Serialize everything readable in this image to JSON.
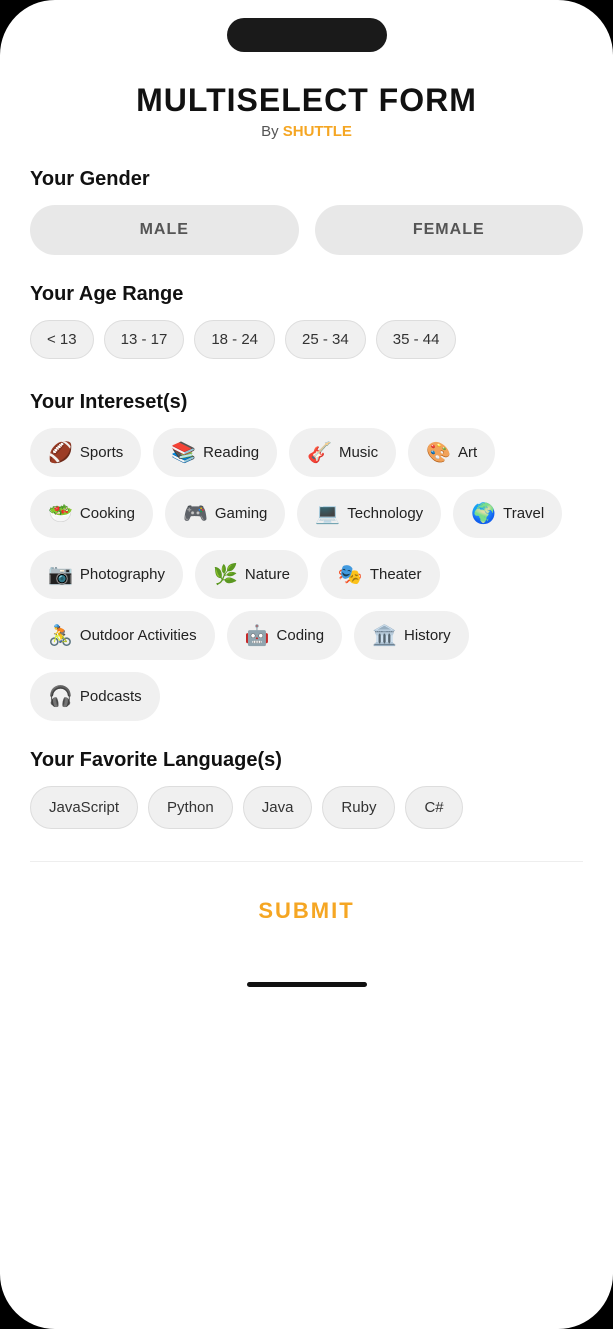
{
  "app": {
    "title": "MULTISELECT FORM",
    "byLine": "By",
    "brand": "SHUTTLE"
  },
  "gender": {
    "label": "Your Gender",
    "options": [
      "MALE",
      "FEMALE"
    ]
  },
  "ageRange": {
    "label": "Your Age Range",
    "options": [
      "< 13",
      "13 - 17",
      "18 - 24",
      "25 - 34",
      "35 - 44"
    ]
  },
  "interests": {
    "label": "Your Intereset(s)",
    "items": [
      {
        "emoji": "🏈",
        "label": "Sports"
      },
      {
        "emoji": "📚",
        "label": "Reading"
      },
      {
        "emoji": "🎸",
        "label": "Music"
      },
      {
        "emoji": "🎨",
        "label": "Art"
      },
      {
        "emoji": "🥗",
        "label": "Cooking"
      },
      {
        "emoji": "🎮",
        "label": "Gaming"
      },
      {
        "emoji": "💻",
        "label": "Technology"
      },
      {
        "emoji": "🌍",
        "label": "Travel"
      },
      {
        "emoji": "📷",
        "label": "Photography"
      },
      {
        "emoji": "🌿",
        "label": "Nature"
      },
      {
        "emoji": "🎭",
        "label": "Theater"
      },
      {
        "emoji": "🚴",
        "label": "Outdoor Activities"
      },
      {
        "emoji": "🤖",
        "label": "Coding"
      },
      {
        "emoji": "🏛️",
        "label": "History"
      },
      {
        "emoji": "🎧",
        "label": "Podcasts"
      }
    ]
  },
  "languages": {
    "label": "Your Favorite Language(s)",
    "options": [
      "JavaScript",
      "Python",
      "Java",
      "Ruby",
      "C#"
    ]
  },
  "submit": {
    "label": "SUBMIT"
  }
}
